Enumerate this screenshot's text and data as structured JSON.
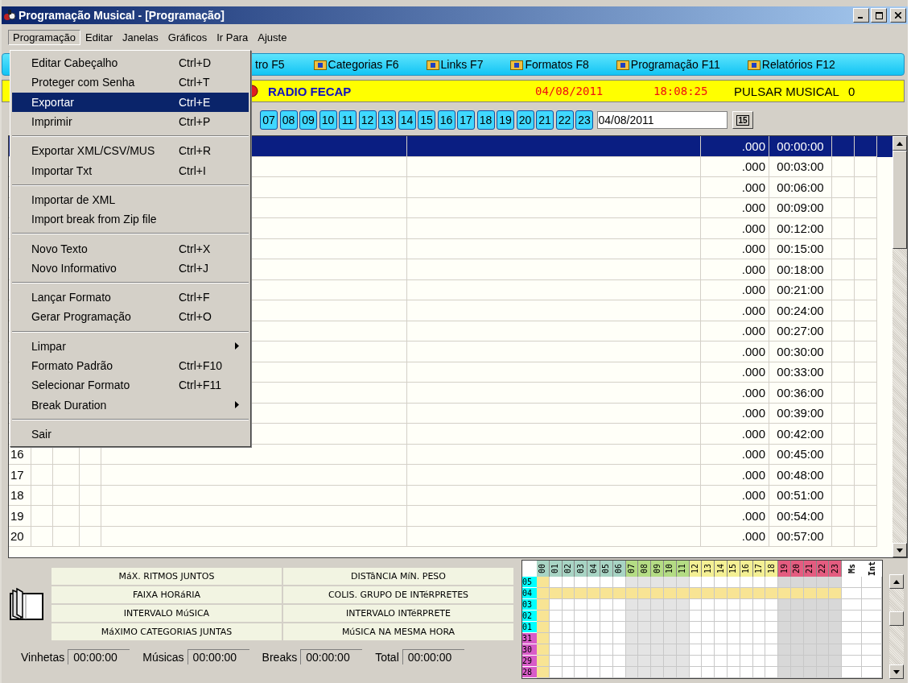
{
  "window": {
    "title": "Programação Musical - [Programação]"
  },
  "menubar": [
    {
      "label": "Programação",
      "selected": true
    },
    {
      "label": "Editar",
      "selected": false
    },
    {
      "label": "Janelas",
      "selected": false
    },
    {
      "label": "Gráficos",
      "selected": false
    },
    {
      "label": "Ir Para",
      "selected": false
    },
    {
      "label": "Ajuste",
      "selected": false
    }
  ],
  "menu": {
    "items": [
      {
        "kind": "item",
        "label": "Editar Cabeçalho",
        "shortcut": "Ctrl+D",
        "selected": false
      },
      {
        "kind": "item",
        "label": "Proteger com Senha",
        "shortcut": "Ctrl+T",
        "selected": false
      },
      {
        "kind": "item",
        "label": "Exportar",
        "shortcut": "Ctrl+E",
        "selected": true
      },
      {
        "kind": "item",
        "label": "Imprimir",
        "shortcut": "Ctrl+P",
        "selected": false
      },
      {
        "kind": "separator"
      },
      {
        "kind": "item",
        "label": "Exportar XML/CSV/MUS",
        "shortcut": "Ctrl+R",
        "selected": false
      },
      {
        "kind": "item",
        "label": "Importar Txt",
        "shortcut": "Ctrl+I",
        "selected": false
      },
      {
        "kind": "separator"
      },
      {
        "kind": "item",
        "label": "Importar de XML",
        "selected": false
      },
      {
        "kind": "item",
        "label": "Import break from Zip file",
        "selected": false
      },
      {
        "kind": "separator"
      },
      {
        "kind": "item",
        "label": "Novo Texto",
        "shortcut": "Ctrl+X",
        "selected": false
      },
      {
        "kind": "item",
        "label": "Novo Informativo",
        "shortcut": "Ctrl+J",
        "selected": false
      },
      {
        "kind": "separator"
      },
      {
        "kind": "item",
        "label": "Lançar Formato",
        "shortcut": "Ctrl+F",
        "selected": false
      },
      {
        "kind": "item",
        "label": "Gerar Programação",
        "shortcut": "Ctrl+O",
        "selected": false
      },
      {
        "kind": "separator"
      },
      {
        "kind": "submenu",
        "label": "Limpar",
        "selected": false
      },
      {
        "kind": "item",
        "label": "Formato Padrão",
        "shortcut": "Ctrl+F10",
        "selected": false
      },
      {
        "kind": "item",
        "label": "Selecionar Formato",
        "shortcut": "Ctrl+F11",
        "selected": false
      },
      {
        "kind": "submenu",
        "label": "Break Duration",
        "selected": false
      },
      {
        "kind": "separator"
      },
      {
        "kind": "item",
        "label": "Sair",
        "selected": false
      }
    ]
  },
  "toolbar": {
    "buttons": [
      {
        "label": "tro F5",
        "icon": false
      },
      {
        "label": "Categorias F6",
        "icon": true
      },
      {
        "label": "Links F7",
        "icon": true
      },
      {
        "label": "Formatos F8",
        "icon": true
      },
      {
        "label": "Programação F11",
        "icon": true
      },
      {
        "label": "Relatórios F12",
        "icon": true
      }
    ]
  },
  "station": {
    "name": "RADIO FECAP",
    "date": "04/08/2011",
    "time": "18:08:25",
    "program": "PULSAR MUSICAL",
    "count": "0"
  },
  "hour_bar": {
    "buttons": [
      "07",
      "08",
      "09",
      "10",
      "11",
      "12",
      "13",
      "14",
      "15",
      "16",
      "17",
      "18",
      "19",
      "20",
      "21",
      "22",
      "23"
    ],
    "date": "04/08/2011",
    "calendar_button": "15"
  },
  "table": {
    "rows": [
      {
        "value": ".000",
        "time": "00:00:00",
        "selected": true
      },
      {
        "value": ".000",
        "time": "00:03:00",
        "selected": false
      },
      {
        "value": ".000",
        "time": "00:06:00",
        "selected": false
      },
      {
        "value": ".000",
        "time": "00:09:00",
        "selected": false
      },
      {
        "value": ".000",
        "time": "00:12:00",
        "selected": false
      },
      {
        "value": ".000",
        "time": "00:15:00",
        "selected": false
      },
      {
        "value": ".000",
        "time": "00:18:00",
        "selected": false
      },
      {
        "value": ".000",
        "time": "00:21:00",
        "selected": false
      },
      {
        "value": ".000",
        "time": "00:24:00",
        "selected": false
      },
      {
        "value": ".000",
        "time": "00:27:00",
        "selected": false
      },
      {
        "value": ".000",
        "time": "00:30:00",
        "selected": false
      },
      {
        "value": ".000",
        "time": "00:33:00",
        "selected": false
      },
      {
        "value": ".000",
        "time": "00:36:00",
        "selected": false
      },
      {
        "value": ".000",
        "time": "00:39:00",
        "selected": false
      },
      {
        "value": ".000",
        "time": "00:42:00",
        "selected": false
      },
      {
        "number": "16",
        "value": ".000",
        "time": "00:45:00",
        "selected": false
      },
      {
        "number": "17",
        "value": ".000",
        "time": "00:48:00",
        "selected": false
      },
      {
        "number": "18",
        "value": ".000",
        "time": "00:51:00",
        "selected": false
      },
      {
        "number": "19",
        "value": ".000",
        "time": "00:54:00",
        "selected": false
      },
      {
        "number": "20",
        "value": ".000",
        "time": "00:57:00",
        "selected": false
      }
    ]
  },
  "rules": [
    "MáX. RITMOS JUNTOS",
    "DISTâNCIA MíN. PESO",
    "FAIXA HORáRIA",
    "COLIS. GRUPO DE INTéRPRETES",
    "INTERVALO MúSICA",
    "INTERVALO INTéRPRETE",
    "MáXIMO CATEGORIAS JUNTAS",
    "MúSICA NA MESMA HORA"
  ],
  "totals": [
    {
      "label": "Vinhetas",
      "value": "00:00:00"
    },
    {
      "label": "Músicas",
      "value": "00:00:00"
    },
    {
      "label": "Breaks",
      "value": "00:00:00"
    },
    {
      "label": "Total",
      "value": "00:00:00"
    }
  ],
  "grid": {
    "hours": [
      {
        "label": "00",
        "color": "#a8d4c4",
        "shaded": false,
        "dark": false,
        "marked": true
      },
      {
        "label": "01",
        "color": "#a8d4c4",
        "shaded": false,
        "dark": false,
        "marked": false
      },
      {
        "label": "02",
        "color": "#a8d4c4",
        "shaded": false,
        "dark": false,
        "marked": false
      },
      {
        "label": "03",
        "color": "#a8d4c4",
        "shaded": false,
        "dark": false,
        "marked": false
      },
      {
        "label": "04",
        "color": "#a8d4c4",
        "shaded": false,
        "dark": false,
        "marked": false
      },
      {
        "label": "05",
        "color": "#a8d4c4",
        "shaded": false,
        "dark": false,
        "marked": false
      },
      {
        "label": "06",
        "color": "#a8d4c4",
        "shaded": false,
        "dark": false,
        "marked": false
      },
      {
        "label": "07",
        "color": "#b4dc84",
        "shaded": true,
        "dark": false,
        "marked": false
      },
      {
        "label": "08",
        "color": "#b4dc84",
        "shaded": true,
        "dark": false,
        "marked": false
      },
      {
        "label": "09",
        "color": "#b4dc84",
        "shaded": true,
        "dark": false,
        "marked": false
      },
      {
        "label": "10",
        "color": "#b4dc84",
        "shaded": true,
        "dark": false,
        "marked": false
      },
      {
        "label": "11",
        "color": "#b4dc84",
        "shaded": true,
        "dark": false,
        "marked": false
      },
      {
        "label": "12",
        "color": "#f4f094",
        "shaded": false,
        "dark": false,
        "marked": false
      },
      {
        "label": "13",
        "color": "#f4f094",
        "shaded": false,
        "dark": false,
        "marked": false
      },
      {
        "label": "14",
        "color": "#f4f094",
        "shaded": false,
        "dark": false,
        "marked": false
      },
      {
        "label": "15",
        "color": "#f4f094",
        "shaded": false,
        "dark": false,
        "marked": false
      },
      {
        "label": "16",
        "color": "#f4f094",
        "shaded": false,
        "dark": false,
        "marked": false
      },
      {
        "label": "17",
        "color": "#f4f094",
        "shaded": false,
        "dark": false,
        "marked": false
      },
      {
        "label": "18",
        "color": "#f4f094",
        "shaded": false,
        "dark": false,
        "marked": false
      },
      {
        "label": "19",
        "color": "#e45c80",
        "shaded": false,
        "dark": true,
        "marked": false
      },
      {
        "label": "20",
        "color": "#e45c80",
        "shaded": false,
        "dark": true,
        "marked": false
      },
      {
        "label": "21",
        "color": "#e45c80",
        "shaded": false,
        "dark": true,
        "marked": false
      },
      {
        "label": "22",
        "color": "#e45c80",
        "shaded": false,
        "dark": true,
        "marked": false
      },
      {
        "label": "23",
        "color": "#e45c80",
        "shaded": false,
        "dark": true,
        "marked": false
      }
    ],
    "extra_columns": [
      "Ms",
      "Int"
    ],
    "rows": [
      {
        "label": "05",
        "color": "#00ffff",
        "highlighted": false
      },
      {
        "label": "04",
        "color": "#00ffff",
        "highlighted": true
      },
      {
        "label": "03",
        "color": "#00ffff",
        "highlighted": false
      },
      {
        "label": "02",
        "color": "#00ffff",
        "highlighted": false
      },
      {
        "label": "01",
        "color": "#00ffff",
        "highlighted": false
      },
      {
        "label": "31",
        "color": "#d85cc8",
        "highlighted": false
      },
      {
        "label": "30",
        "color": "#d85cc8",
        "highlighted": false
      },
      {
        "label": "29",
        "color": "#d85cc8",
        "highlighted": false
      },
      {
        "label": "28",
        "color": "#d85cc8",
        "highlighted": false
      }
    ]
  }
}
